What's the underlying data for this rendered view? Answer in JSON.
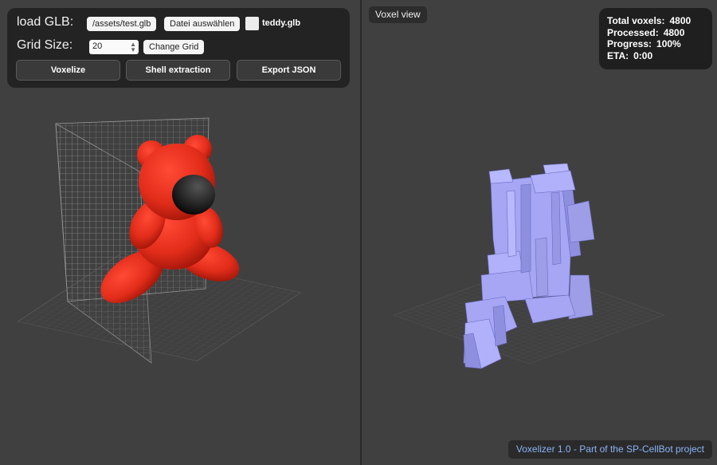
{
  "controls": {
    "load_label": "load GLB:",
    "file_path": "/assets/test.glb",
    "choose_file_label": "Datei auswählen",
    "file_name": "teddy.glb",
    "grid_label": "Grid Size:",
    "grid_value": "20",
    "change_grid_label": "Change Grid",
    "voxelize_label": "Voxelize",
    "shell_label": "Shell extraction",
    "export_label": "Export JSON"
  },
  "voxel_view": {
    "label": "Voxel view",
    "stats": {
      "total_label": "Total voxels:",
      "total_value": "4800",
      "processed_label": "Processed:",
      "processed_value": "4800",
      "progress_label": "Progress:",
      "progress_value": "100%",
      "eta_label": "ETA:",
      "eta_value": "0:00"
    }
  },
  "footer": {
    "text": "Voxelizer 1.0 - Part of the SP-CellBot project"
  },
  "colors": {
    "background": "#404040",
    "panel": "#232323",
    "model_red": "#e32d1b",
    "voxel_lavender": "#a6a6f5",
    "footer_text": "#8ab4f8"
  },
  "icons": [
    "spinner-arrows-icon",
    "color-swatch-icon"
  ]
}
